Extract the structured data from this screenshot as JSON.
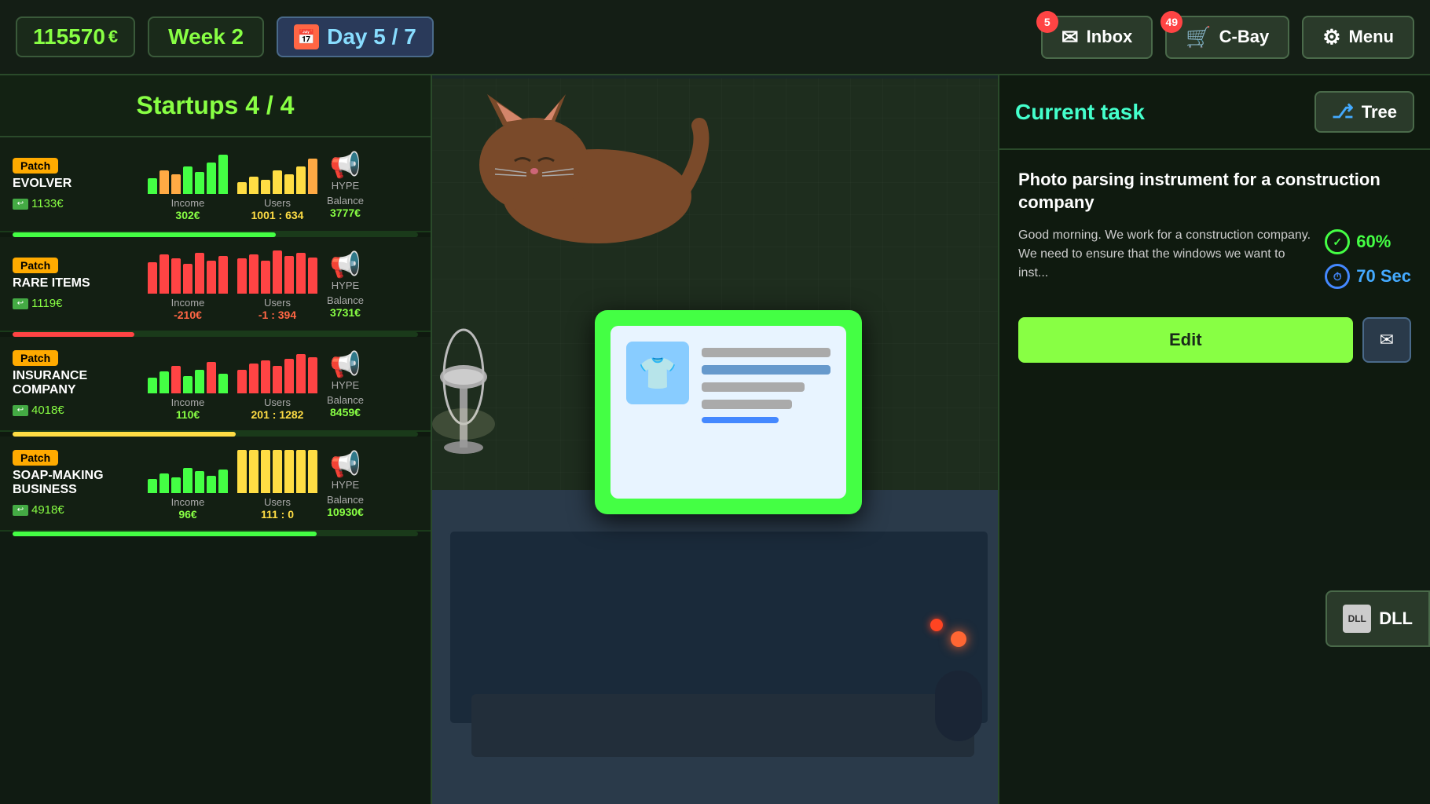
{
  "topbar": {
    "currency": "115570",
    "currency_symbol": "€",
    "week": "Week 2",
    "day": "Day 5 / 7",
    "inbox_label": "Inbox",
    "inbox_badge": "5",
    "cbay_label": "C-Bay",
    "cbay_badge": "49",
    "menu_label": "Menu"
  },
  "startups_panel": {
    "title": "Startups 4 / 4",
    "cards": [
      {
        "badge": "Patch",
        "name": "EVOLVER",
        "cost": "1133€",
        "income_label": "Income",
        "income_value": "302€",
        "users_label": "Users",
        "users_value": "1001 : 634",
        "users_color": "yellow",
        "balance_label": "Balance",
        "balance_value": "3777€",
        "hype_active": false
      },
      {
        "badge": "Patch",
        "name": "RARE ITEMS",
        "cost": "1119€",
        "income_label": "Income",
        "income_value": "-210€",
        "users_label": "Users",
        "users_value": "-1 : 394",
        "users_color": "red",
        "balance_label": "Balance",
        "balance_value": "3731€",
        "hype_active": false
      },
      {
        "badge": "Patch",
        "name": "INSURANCE COMPANY",
        "cost": "4018€",
        "income_label": "Income",
        "income_value": "110€",
        "users_label": "Users",
        "users_value": "201 : 1282",
        "users_color": "yellow",
        "balance_label": "Balance",
        "balance_value": "8459€",
        "hype_active": false
      },
      {
        "badge": "Patch",
        "name": "SOAP-MAKING BUSINESS",
        "cost": "4918€",
        "income_label": "Income",
        "income_value": "96€",
        "users_label": "Users",
        "users_value": "111 : 0",
        "users_color": "green",
        "balance_label": "Balance",
        "balance_value": "10930€",
        "hype_active": true
      }
    ]
  },
  "right_panel": {
    "current_task_label": "Current task",
    "tree_label": "Tree",
    "task_title": "Photo parsing instrument for a construction company",
    "task_desc": "Good morning. We work for a construction company. We need to ensure that the windows we want to inst...",
    "progress_label": "60%",
    "time_label": "70 Sec",
    "edit_label": "Edit",
    "dll_label": "DLL"
  },
  "popup": {
    "visible": true
  }
}
